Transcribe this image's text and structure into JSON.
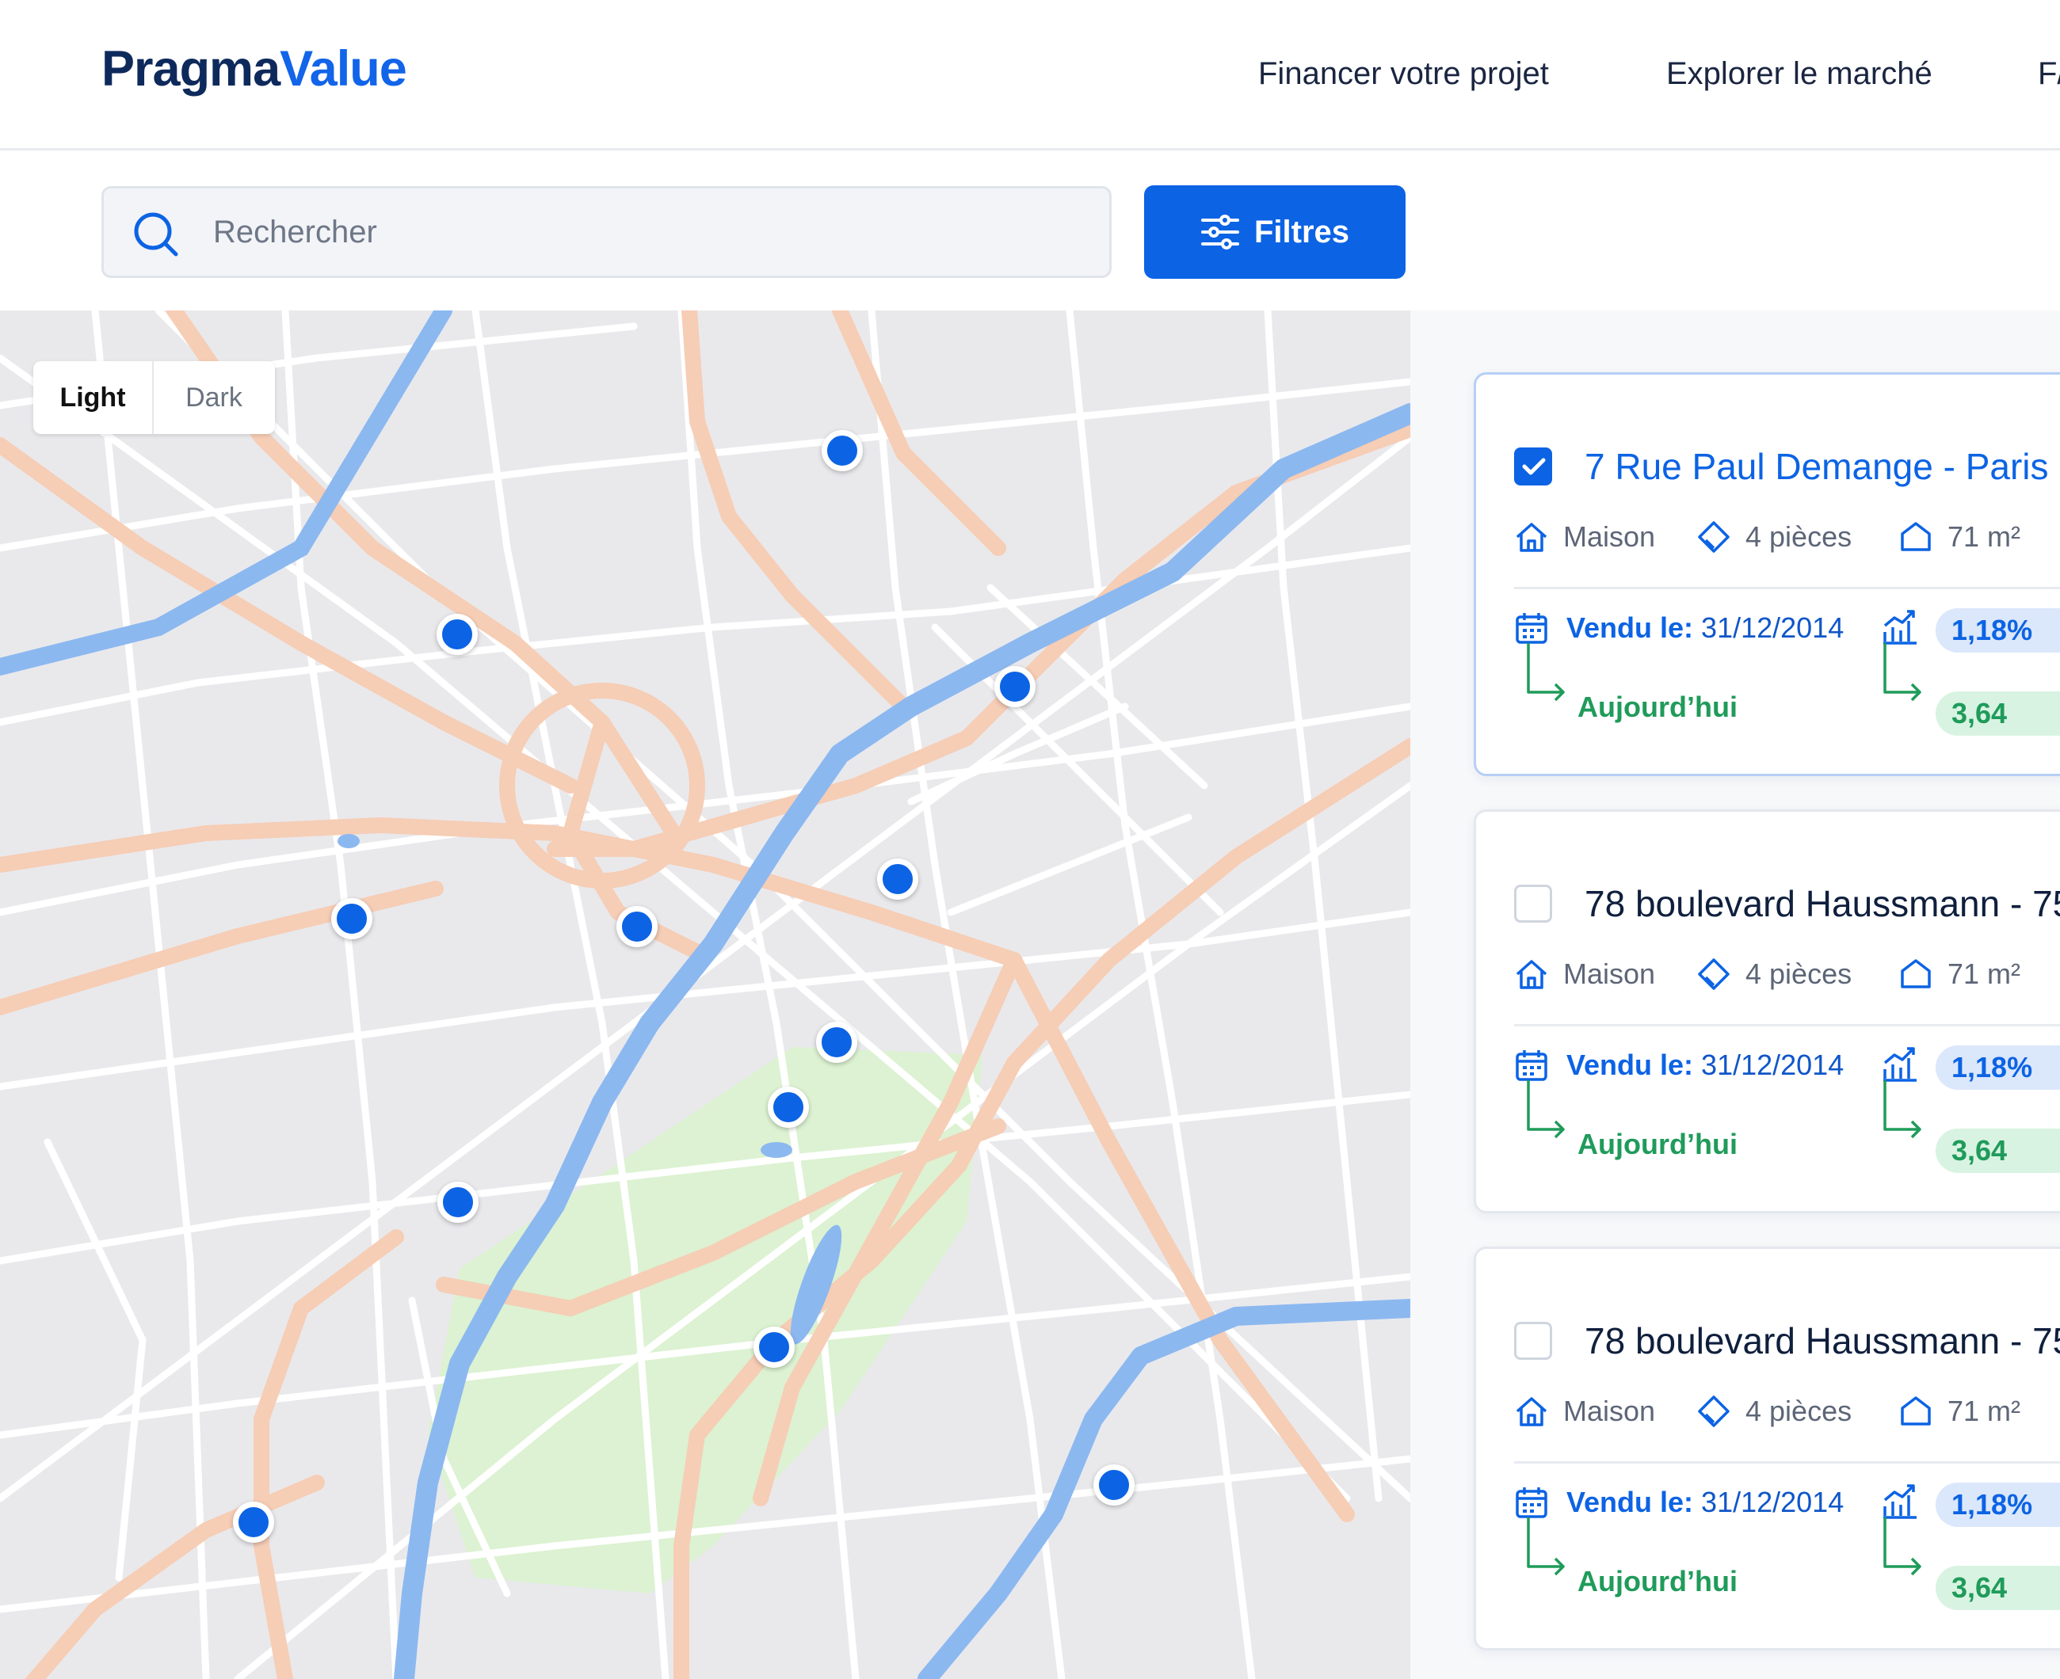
{
  "header": {
    "logo_part1": "Pragma",
    "logo_part2": "Value",
    "nav": [
      "Financer votre projet",
      "Explorer le marché",
      "F/"
    ]
  },
  "search": {
    "placeholder": "Rechercher",
    "value": ""
  },
  "filters": {
    "label": "Filtres"
  },
  "map": {
    "theme_options": [
      "Light",
      "Dark"
    ],
    "selected_theme": "Light",
    "pin_count": 13
  },
  "listings": [
    {
      "address": "7 Rue Paul Demange - Paris",
      "selected": true,
      "type": "Maison",
      "rooms": "4 pièces",
      "area": "71 m²",
      "sold_label": "Vendu le:",
      "sold_date": "31/12/2014",
      "today_label": "Aujourd’hui",
      "growth_value": "1,18%",
      "today_value": "3,64"
    },
    {
      "address": "78 boulevard Haussmann - 75",
      "selected": false,
      "type": "Maison",
      "rooms": "4 pièces",
      "area": "71 m²",
      "sold_label": "Vendu le:",
      "sold_date": "31/12/2014",
      "today_label": "Aujourd’hui",
      "growth_value": "1,18%",
      "today_value": "3,64"
    },
    {
      "address": "78 boulevard Haussmann - 75",
      "selected": false,
      "type": "Maison",
      "rooms": "4 pièces",
      "area": "71 m²",
      "sold_label": "Vendu le:",
      "sold_date": "31/12/2014",
      "today_label": "Aujourd’hui",
      "growth_value": "1,18%",
      "today_value": "3,64"
    }
  ],
  "colors": {
    "brand_dark": "#0e2a5c",
    "brand_blue": "#0c63e4",
    "positive_green": "#1f9b5a",
    "river": "#8cb8f0",
    "park": "#dcf2d2",
    "major_road": "#f6cdb5"
  }
}
